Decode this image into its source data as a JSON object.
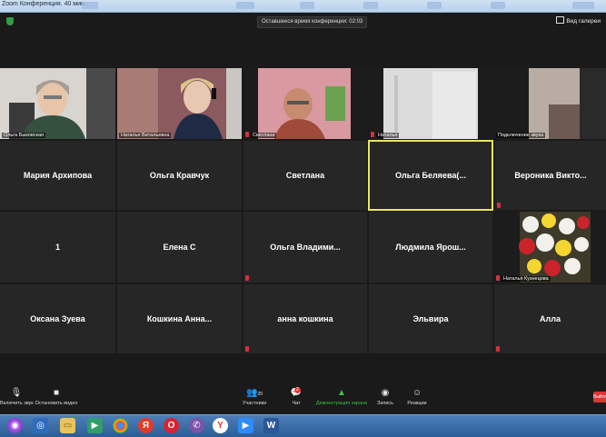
{
  "window": {
    "title": "Zoom Конференция. 40 мин"
  },
  "header": {
    "timer": "Оставшееся время конференции: 02:03",
    "view_mode": "Вид галереи"
  },
  "gallery": {
    "video_tiles": [
      {
        "label": "Ольга Быковская"
      },
      {
        "label": "Наталья Витальевна"
      },
      {
        "label": "Светлана"
      },
      {
        "label": "Наталья"
      },
      {
        "label": "Подключение звука"
      }
    ],
    "rows": [
      [
        "Мария Архипова",
        "Ольга Кравчук",
        "Светлана",
        "Ольга  Беляева(...",
        "Вероника  Викто..."
      ],
      [
        "1",
        "Елена С",
        "Ольга  Владими...",
        "Людмила  Ярош...",
        ""
      ],
      [
        "Оксана Зуева",
        "Кошкина  Анна...",
        "анна кошкина",
        "Эльвира",
        "Алла"
      ]
    ],
    "flowers_label": "Наталья Кузнецова"
  },
  "toolbar": {
    "audio": "Включить звук",
    "video": "Остановить видео",
    "participants": "Участники",
    "participants_count": "20",
    "chat": "Чат",
    "chat_badge": "2",
    "share": "Демонстрация экрана",
    "record": "Запись",
    "reactions": "Реакции",
    "end": "Выйти"
  },
  "taskbar": {
    "apps": [
      "yandex-alice-icon",
      "explorer-icon",
      "chrome-icon",
      "yandex-browser-icon",
      "opera-icon",
      "viber-icon",
      "yandex-icon",
      "zoom-icon",
      "word-icon"
    ]
  },
  "colors": {
    "accent_green": "#3fbf4a",
    "active_border": "#e9e65a",
    "mute_red": "#d6303a"
  }
}
